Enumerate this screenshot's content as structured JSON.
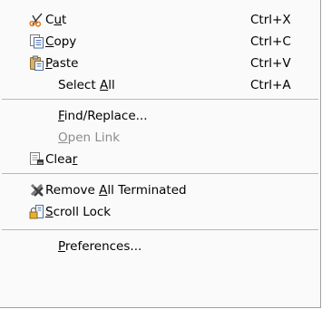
{
  "menu": {
    "items": [
      {
        "pre": "C",
        "mn": "u",
        "post": "t",
        "shortcut": "Ctrl+X",
        "icon": "scissors-icon"
      },
      {
        "pre": "",
        "mn": "C",
        "post": "opy",
        "shortcut": "Ctrl+C",
        "icon": "copy-icon"
      },
      {
        "pre": "",
        "mn": "P",
        "post": "aste",
        "shortcut": "Ctrl+V",
        "icon": "paste-icon"
      },
      {
        "pre": "Select ",
        "mn": "A",
        "post": "ll",
        "shortcut": "Ctrl+A",
        "icon": ""
      },
      {
        "pre": "",
        "mn": "F",
        "post": "ind/Replace...",
        "shortcut": "",
        "icon": ""
      },
      {
        "pre": "",
        "mn": "O",
        "post": "pen Link",
        "shortcut": "",
        "icon": "",
        "disabled": true
      },
      {
        "pre": "Clea",
        "mn": "r",
        "post": "",
        "shortcut": "",
        "icon": "clear-console-icon"
      },
      {
        "pre": "Remove ",
        "mn": "A",
        "post": "ll Terminated",
        "shortcut": "",
        "icon": "remove-terminated-icon"
      },
      {
        "pre": "",
        "mn": "S",
        "post": "croll Lock",
        "shortcut": "",
        "icon": "scroll-lock-icon"
      },
      {
        "pre": "",
        "mn": "P",
        "post": "references...",
        "shortcut": "",
        "icon": ""
      }
    ]
  },
  "colors": {
    "menu_bg": "#fafafa",
    "separator": "#b8b8b8",
    "disabled_text": "#8c8c8c"
  }
}
